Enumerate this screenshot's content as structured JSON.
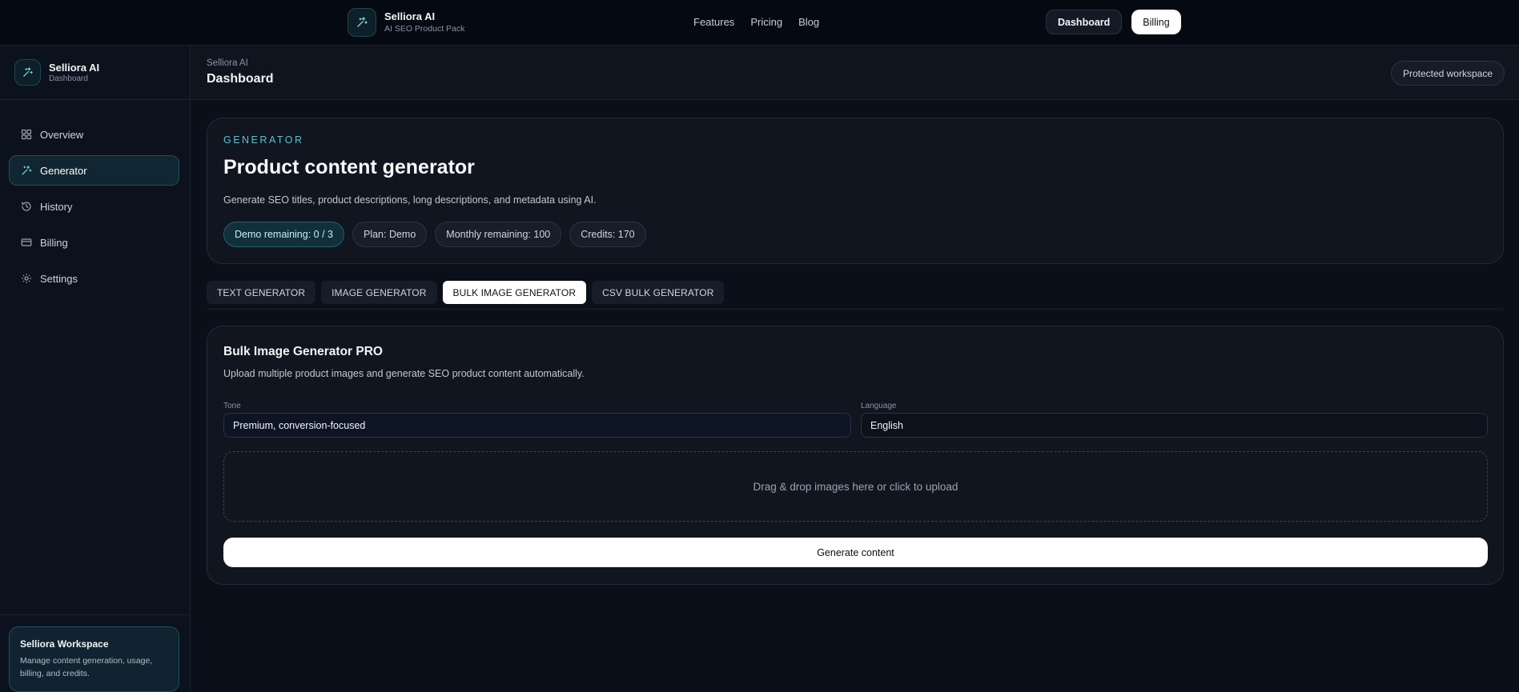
{
  "topnav": {
    "brand_name": "Selliora AI",
    "brand_sub": "AI SEO Product Pack",
    "links": [
      "Features",
      "Pricing",
      "Blog"
    ],
    "dashboard_label": "Dashboard",
    "billing_label": "Billing"
  },
  "sidebar": {
    "brand_name": "Selliora AI",
    "brand_sub": "Dashboard",
    "items": [
      {
        "label": "Overview",
        "icon": "grid-icon"
      },
      {
        "label": "Generator",
        "icon": "wand-icon",
        "active": true
      },
      {
        "label": "History",
        "icon": "history-icon"
      },
      {
        "label": "Billing",
        "icon": "card-icon"
      },
      {
        "label": "Settings",
        "icon": "gear-icon"
      }
    ],
    "card_title": "Selliora Workspace",
    "card_desc": "Manage content generation, usage, billing, and credits."
  },
  "header": {
    "crumb": "Selliora AI",
    "title": "Dashboard",
    "badge": "Protected workspace"
  },
  "hero": {
    "eyebrow": "GENERATOR",
    "title": "Product content generator",
    "desc": "Generate SEO titles, product descriptions, long descriptions, and metadata using AI.",
    "chips": [
      "Demo remaining: 0 / 3",
      "Plan: Demo",
      "Monthly remaining: 100",
      "Credits: 170"
    ]
  },
  "tabs": [
    {
      "label": "TEXT GENERATOR"
    },
    {
      "label": "IMAGE GENERATOR"
    },
    {
      "label": "BULK IMAGE GENERATOR",
      "active": true
    },
    {
      "label": "CSV BULK GENERATOR"
    }
  ],
  "form": {
    "title": "Bulk Image Generator PRO",
    "desc": "Upload multiple product images and generate SEO product content automatically.",
    "tone_label": "Tone",
    "tone_value": "Premium, conversion-focused",
    "language_label": "Language",
    "language_value": "English",
    "dropzone_text": "Drag & drop images here or click to upload",
    "generate_label": "Generate content"
  },
  "colors": {
    "background": "#0a0f1a",
    "accent": "#56c2d6",
    "active_nav_bg": "#102632",
    "card_bg": "#10151f"
  }
}
